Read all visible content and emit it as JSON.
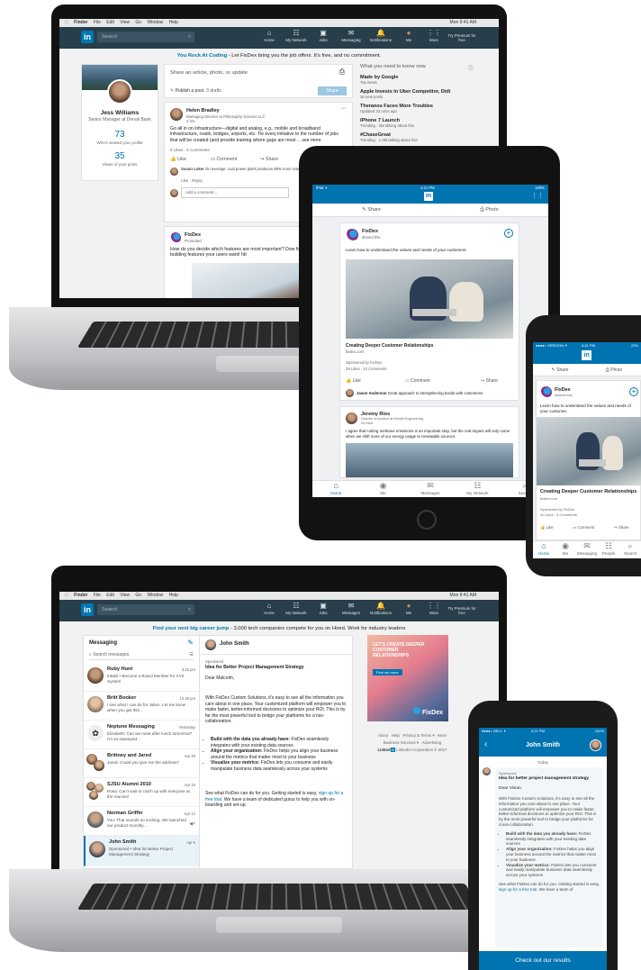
{
  "desktop1": {
    "menubar": {
      "items": [
        "Finder",
        "File",
        "Edit",
        "View",
        "Go",
        "Window",
        "Help"
      ],
      "clock": "Mon 9:41 AM"
    },
    "search_placeholder": "Search",
    "nav": [
      {
        "icon": "⌂",
        "label": "Home"
      },
      {
        "icon": "☷",
        "label": "My Network"
      },
      {
        "icon": "▣",
        "label": "Jobs"
      },
      {
        "icon": "✉",
        "label": "Messaging"
      },
      {
        "icon": "🔔",
        "label": "Notifications"
      },
      {
        "icon": "●",
        "label": "Me"
      },
      {
        "icon": "⋮⋮",
        "label": "More"
      },
      {
        "icon": "",
        "label": "Try Premium for free"
      }
    ],
    "promo": {
      "link": "You Rock At Coding",
      "text": " - Let FixDex bring you the job offers. It's free, and no commitment."
    },
    "profile": {
      "name": "Jess Williams",
      "title": "Senior Manager at Denali Bank",
      "views_count": "73",
      "views_label": "Who's viewed your profile",
      "post_views_count": "35",
      "post_views_label": "Views of your posts"
    },
    "share": {
      "placeholder": "Share an article, photo, or update",
      "publish": "Publish a post",
      "drafts": "· 3 drafts",
      "button": "Share"
    },
    "post": {
      "author": "Helen Bradley",
      "headline": "Managing Director at Philosophy Science LLC",
      "time": "2 hrs",
      "body": "Go all in on infrastructure—digital and analog, e.g., mobile and broadband infrastructure, roads, bridges, airports, etc. Tie every initiative to the number of jobs that will be created (and provide training where gaps are most ... see more",
      "stats": "8 Likes · 5 Comments",
      "like": "Like",
      "comment": "Comment",
      "share": "Share",
      "commenter": "Susan Loker",
      "comment_text": "On average, coal power plant produces 88% more natural gas power plant.",
      "comment_like": "Like",
      "comment_reply": "Reply",
      "add_comment": "Add a comment..."
    },
    "ad": {
      "name": "FixDex",
      "promoted": "Promoted",
      "text": "How do you decide which features are most important? Dow for a complete guide to building features your users want! htt"
    },
    "news": {
      "title": "What you need to know now",
      "items": [
        {
          "title": "Made by Google",
          "sub": "Top News"
        },
        {
          "title": "Apple Invests In Uber Competitor, Didi",
          "sub": "36 new posts"
        },
        {
          "title": "Theranos Faces More Troubles",
          "sub": "Updated 33 mins ago"
        },
        {
          "title": "iPhone 7 Launch",
          "sub": "Trending · 2M talking about this"
        },
        {
          "title": "#ChaseGreat",
          "sub": "Trending · 1.3M talking about this"
        }
      ]
    }
  },
  "tablet": {
    "status_left": "iPad ✦",
    "status_time": "4:21 PM",
    "status_right": "100%",
    "share": "Share",
    "photo": "Photo",
    "post": {
      "company": "FixDex",
      "sub": "shared this",
      "text": "Learn how to understand the values and needs of your customers.",
      "caption": "Creating Deeper Customer Relationships",
      "domain": "fixdex.com",
      "sponsored": "Sponsored by FixDex",
      "stats": "29 Likes · 12 Comments",
      "like": "Like",
      "comment": "Comment",
      "share": "Share",
      "commenter": "Jason Anderson",
      "comment_text": "Great approach to strengthening bonds with customers!"
    },
    "post2": {
      "author": "Jeremy Rios",
      "headline": "Director of product at Moxxit Engineering",
      "time": "20 mins",
      "text": "I agree that cutting methane emissions is an important step, but the real impact will only come when we shift more of our energy usage to renewable sources."
    },
    "tabs": [
      {
        "icon": "⌂",
        "label": "Home"
      },
      {
        "icon": "◉",
        "label": "Me"
      },
      {
        "icon": "✉",
        "label": "Messages"
      },
      {
        "icon": "☷",
        "label": "My Network"
      },
      {
        "icon": "⌕",
        "label": "Search"
      }
    ]
  },
  "phone1": {
    "status_left": "●●●●○ VERIZON ✦",
    "status_time": "4:21 PM",
    "status_right": "22%",
    "share": "Share",
    "photo": "Photo",
    "post": {
      "company": "FixDex",
      "sub": "shared this",
      "text": "Learn how to understand the values and needs of your customer.",
      "caption": "Creating Deeper Customer Relationships",
      "domain": "fixdex.com",
      "sponsored": "Sponsored by FixDex",
      "stats": "11 Likes · 3 Comments",
      "like": "Like",
      "comment": "Comment",
      "share": "Share"
    },
    "tabs": [
      {
        "icon": "⌂",
        "label": "Home"
      },
      {
        "icon": "◉",
        "label": "Me"
      },
      {
        "icon": "✉",
        "label": "Messaging"
      },
      {
        "icon": "☷",
        "label": "People"
      },
      {
        "icon": "⌕",
        "label": "Search"
      }
    ]
  },
  "desktop2": {
    "menubar": {
      "items": [
        "Finder",
        "File",
        "Edit",
        "View",
        "Go",
        "Window",
        "Help"
      ],
      "clock": "Mon 9:41 AM"
    },
    "search_placeholder": "Search",
    "nav": [
      {
        "icon": "⌂",
        "label": "Home"
      },
      {
        "icon": "☷",
        "label": "My Network"
      },
      {
        "icon": "▣",
        "label": "Jobs"
      },
      {
        "icon": "✉",
        "label": "Messages"
      },
      {
        "icon": "🔔",
        "label": "Notifications"
      },
      {
        "icon": "●",
        "label": "Me"
      },
      {
        "icon": "⋮⋮",
        "label": "More"
      },
      {
        "icon": "",
        "label": "Try Premium for free"
      }
    ],
    "promo": {
      "link": "Find your next big career jump",
      "text": " - 3,000 tech companies compete for you on Hired. Work for industry leaders"
    },
    "messaging_title": "Messaging",
    "search_messages": "Search messages",
    "threads": [
      {
        "name": "Ruby Hunt",
        "time": "3:15 pm",
        "preview": "InMail • Become a Board Member for XYZ System"
      },
      {
        "name": "Britt Booker",
        "time": "12:48 pm",
        "preview": "I see what I can do for Julien. Let me know when you get this..."
      },
      {
        "name": "Neptune Messaging",
        "time": "Yesterday",
        "preview": "Elizabeth: Can we meet after lunch tomorrow? I'm so swamped..."
      },
      {
        "name": "Brittney and Jared",
        "time": "Apr 20",
        "preview": "Jared: Could you give me the address?"
      },
      {
        "name": "SJSU Alumni 2010",
        "time": "Apr 15",
        "preview": "Rosa: Can't wait to catch up with everyone at the reunion!"
      },
      {
        "name": "Norman Griffin",
        "time": "Apr 12",
        "preview": "You: That sounds so exciting. We launched our product recently..."
      },
      {
        "name": "John Smith",
        "time": "Apr 6",
        "preview": "Sponsored • Idea for Better Project Management Strategy"
      }
    ],
    "conversation": {
      "name": "John Smith",
      "sponsored": "Sponsored",
      "subject": "Idea for Better Project Management Strategy",
      "greeting": "Dear Malcolm,",
      "para1": "With FixDex Custom Solutions, it's easy to see all the information you care about in one place. Your customized platform will empower you to make faster, better-informed decisions to optimize your ROI. This is by far the most powerful tool to bridge your platforms for cross-collaboration.",
      "bullets": [
        {
          "b": "Build with the data you already have:",
          "t": " FixDex seamlessly integrates with your existing data sources"
        },
        {
          "b": "Align your organization:",
          "t": " FixDex helps you align your business around the metrics that matter most to your business"
        },
        {
          "b": "Visualize your metrics:",
          "t": " FixDex lets you consume and easily manipulate business data seamlessly across your systems"
        }
      ],
      "cta_pre": "See what FixDex can do for you. Getting started is easy, ",
      "cta_link": "sign up for a free trial",
      "cta_post": ". We have a team of dedicated gurus to help you with on-boarding and set-up."
    },
    "ad_text": "LET'S CREATE DEEPER CUSTOMER RELATIONSHIPS",
    "ad_button": "Find out more",
    "ad_brand": "FixDex",
    "footer": {
      "links": [
        "About",
        "Help",
        "Privacy & Terms ▾",
        "More",
        "Business Services ▾",
        "Advertising"
      ],
      "copyright": "LinkedIn Corporation © 2017"
    }
  },
  "phone2": {
    "status_left": "●●●●○ BELL ✦",
    "status_time": "4:21 PM",
    "status_right": "100%",
    "title": "John Smith",
    "date": "Today",
    "sponsored": "Sponsored",
    "subject": "Idea for better project management strategy",
    "greeting": "Dear Vivian,",
    "para1": "With FixDex Custom Solutions, it's easy to see all the information you care about in one place. Your customized platform will empower you to make faster, better-informed decisions to optimize your ROI. This is by the most powerful tool to bridge your platforms for cross-collaboration.",
    "bullets": [
      {
        "b": "Build with the data you already have:",
        "t": " FixDex seamlessly integrates with your existing data sources"
      },
      {
        "b": "Align your organization:",
        "t": " FixDex helps you align your business around the metrics that matter most to your business"
      },
      {
        "b": "Visualize your metrics:",
        "t": " FixDex lets you consume and easily manipulate business data seamlessly across your systems"
      }
    ],
    "cta_pre": "See what FixDex can do for you. Getting started is easy, ",
    "cta_link": "sign up for a free trial",
    "cta_post": ". We have a team of",
    "button": "Check out our results"
  },
  "colors": {
    "linkedin_dark": "#283e4a",
    "linkedin_blue": "#0073b1",
    "brand_blue": "#0077b5"
  }
}
